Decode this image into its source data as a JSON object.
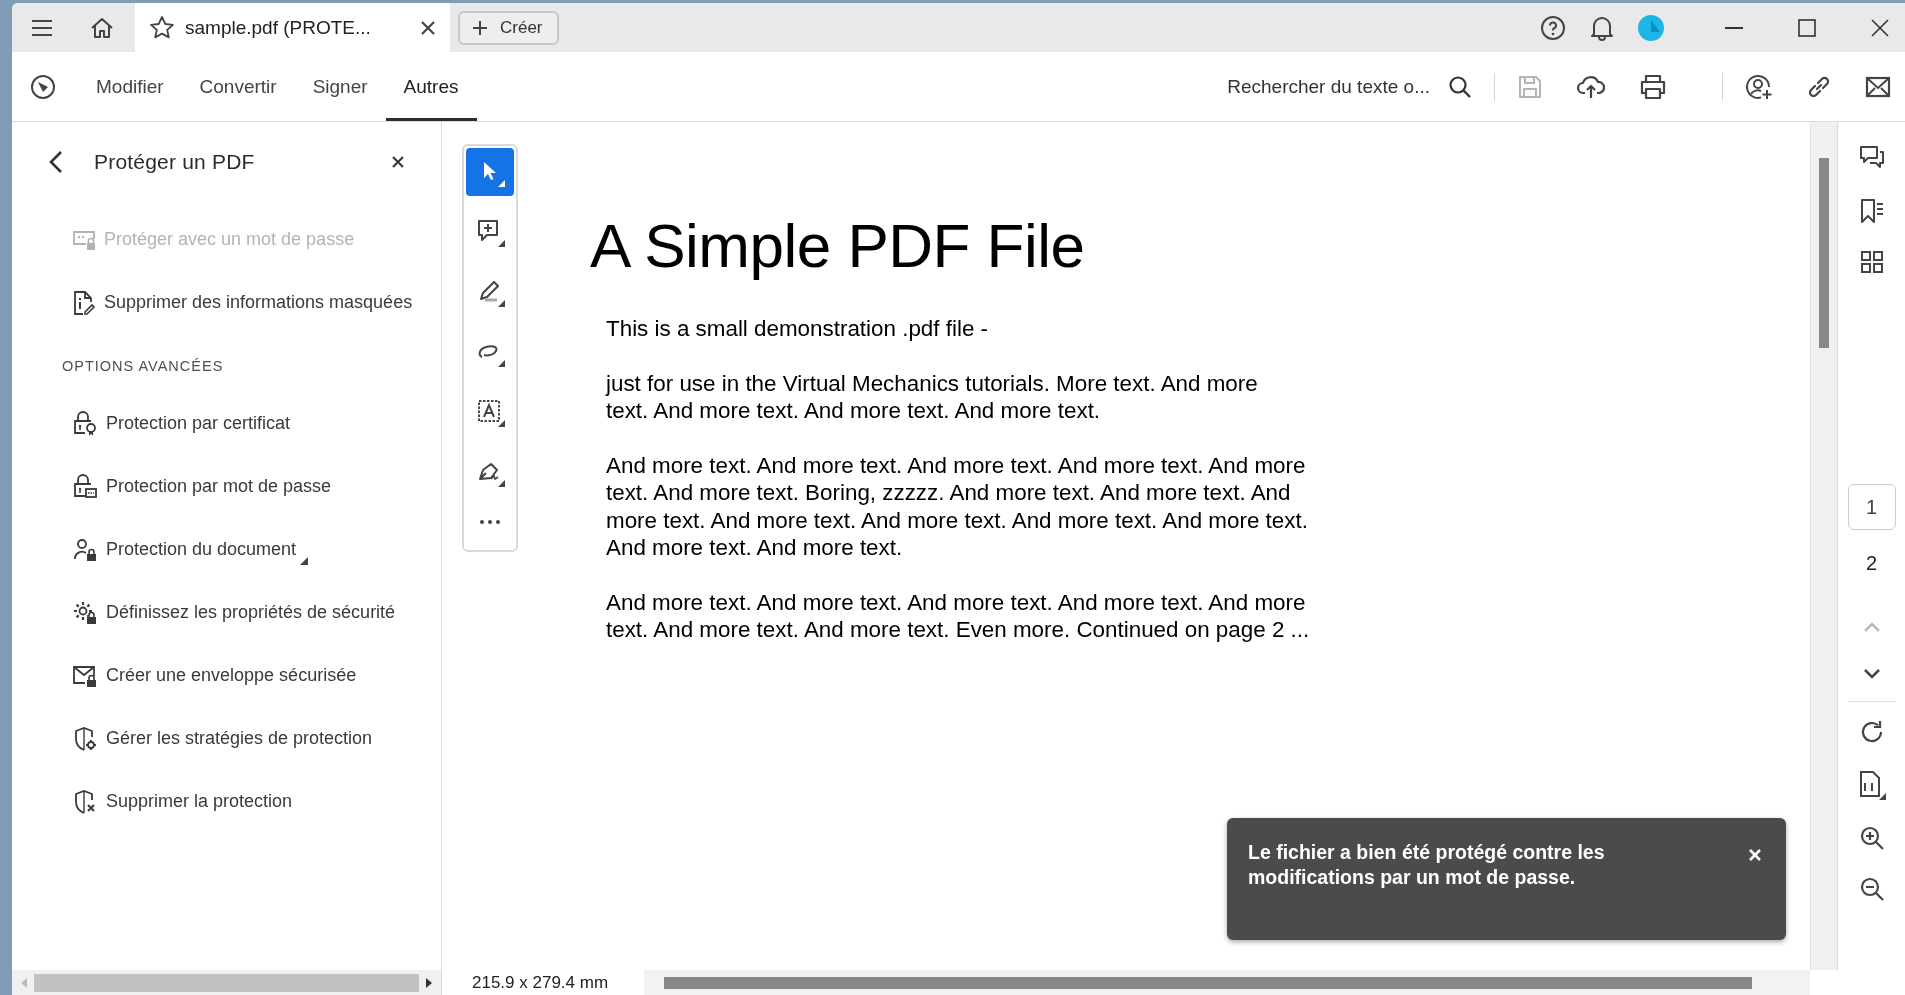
{
  "titlebar": {
    "tab_title": "sample.pdf (PROTE...",
    "create_button": "Créer"
  },
  "toolbar": {
    "tabs": [
      {
        "label": "Modifier",
        "selected": false
      },
      {
        "label": "Convertir",
        "selected": false
      },
      {
        "label": "Signer",
        "selected": false
      },
      {
        "label": "Autres",
        "selected": true
      }
    ],
    "search": {
      "placeholder": "Rechercher du texte o..."
    },
    "save_disabled": true
  },
  "panel": {
    "title": "Protéger un PDF",
    "items": [
      {
        "label": "Protéger avec un mot de passe",
        "disabled": true
      },
      {
        "label": "Supprimer des informations masquées",
        "disabled": false
      }
    ],
    "section_label": "OPTIONS AVANCÉES",
    "advanced_items": [
      {
        "label": "Protection par certificat",
        "flyout": false
      },
      {
        "label": "Protection par mot de passe",
        "flyout": false
      },
      {
        "label": "Protection du document",
        "flyout": true
      },
      {
        "label": "Définissez les propriétés de sécurité",
        "flyout": false
      },
      {
        "label": "Créer une enveloppe sécurisée",
        "flyout": false
      },
      {
        "label": "Gérer les stratégies de protection",
        "flyout": false
      },
      {
        "label": "Supprimer la protection",
        "flyout": false
      }
    ]
  },
  "tools": [
    {
      "selected": true
    },
    {
      "selected": false
    },
    {
      "selected": false
    },
    {
      "selected": false
    },
    {
      "selected": false
    },
    {
      "selected": false
    }
  ],
  "document": {
    "title": "A Simple PDF File",
    "paragraphs": [
      [
        "This is a small demonstration .pdf file -"
      ],
      [
        "just for use in the Virtual Mechanics tutorials. More text. And more",
        "text. And more text. And more text. And more text."
      ],
      [
        "And more text. And more text. And more text. And more text. And more",
        "text. And more text. Boring, zzzzz. And more text. And more text. And",
        "more text. And more text. And more text. And more text. And more text.",
        "And more text. And more text."
      ],
      [
        "And more text. And more text. And more text. And more text. And more",
        "text. And more text. And more text. Even more. Continued on page 2 ..."
      ]
    ]
  },
  "page_nav": {
    "pages": [
      {
        "label": "1",
        "selected": true
      },
      {
        "label": "2",
        "selected": false
      }
    ],
    "prev_disabled": true
  },
  "status": {
    "page_size": "215.9 x 279.4 mm"
  },
  "toast": {
    "message": "Le fichier a bien été protégé contre les modifications par un mot de passe."
  }
}
